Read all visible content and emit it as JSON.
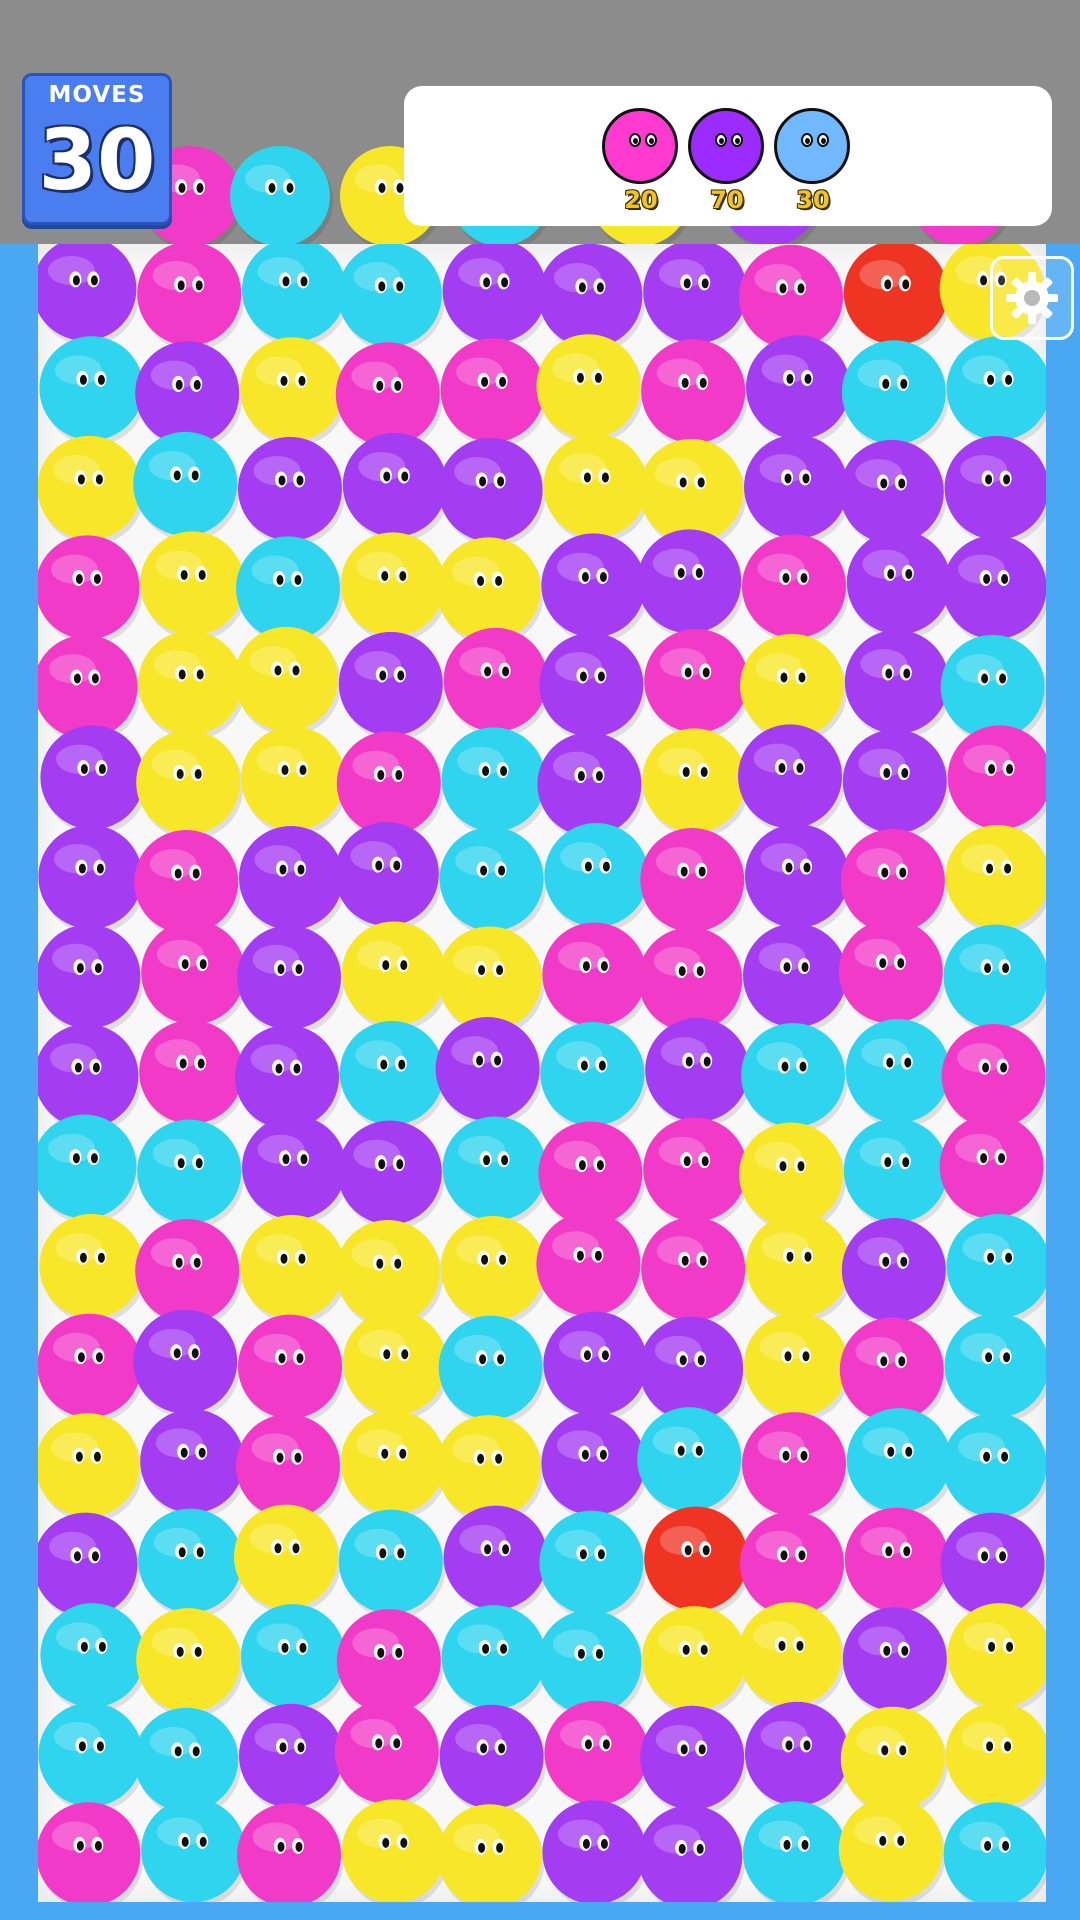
{
  "moves": {
    "label": "MOVES",
    "count": "30"
  },
  "goals": [
    {
      "color": "#ff3ad0",
      "count": "20"
    },
    {
      "color": "#9b2bff",
      "count": "70"
    },
    {
      "color": "#72b8ff",
      "count": "30"
    }
  ],
  "settings": {
    "icon": "gear-icon"
  },
  "palette": {
    "P": "#a43cf2",
    "M": "#f23ac8",
    "C": "#2fd4ee",
    "Y": "#f8e728",
    "R": "#f03424"
  },
  "peek": [
    "M",
    "C",
    "Y",
    "C",
    "Y",
    "P",
    "M"
  ],
  "board": [
    "PMCCPPPMRY",
    "CPYMMYMPCC",
    "YCPPPYYPPP",
    "MYCYYPPMPP",
    "MYYPMPMYPC",
    "PYYMCPYPPM",
    "PMPPCCMPMY",
    "PMPYYMMPMC",
    "PMPCPCPCCM",
    "CCPPCMMYCM",
    "YMYYYMMYPC",
    "MPMYCPPYMC",
    "YPMYYPCMCC",
    "PCYCPCRMMP",
    "CYCMCCYYPY",
    "CCPMPMPPYY",
    "MCMYYPPCYC"
  ]
}
